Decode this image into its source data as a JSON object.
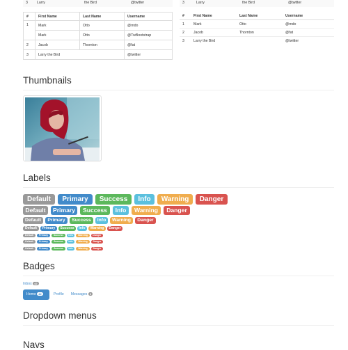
{
  "top_left_remnant": {
    "num": "3",
    "first": "Larry",
    "last": "the Bird",
    "user": "@twitter"
  },
  "top_right_remnant": {
    "num": "3",
    "first": "Larry",
    "last": "the Bird",
    "user": "@twitter"
  },
  "table_left": {
    "headers": [
      "#",
      "First Name",
      "Last Name",
      "Username"
    ],
    "rows": [
      [
        "1",
        "Mark",
        "Otto",
        "@mdo"
      ],
      [
        "",
        "Mark",
        "Otto",
        "@TwBootstrap"
      ],
      [
        "2",
        "Jacob",
        "Thornton",
        "@fat"
      ],
      [
        "3",
        "Larry the Bird",
        "",
        "@twitter"
      ]
    ]
  },
  "table_right": {
    "headers": [
      "#",
      "First Name",
      "Last Name",
      "Username"
    ],
    "rows": [
      [
        "1",
        "Mark",
        "Otto",
        "@mdo"
      ],
      [
        "2",
        "Jacob",
        "Thornton",
        "@fat"
      ],
      [
        "3",
        "Larry the Bird",
        "",
        "@twitter"
      ]
    ]
  },
  "sections": {
    "thumbnails": "Thumbnails",
    "labels": "Labels",
    "badges": "Badges",
    "dropdowns": "Dropdown menus",
    "navs": "Navs"
  },
  "labels": [
    "Default",
    "Primary",
    "Success",
    "Info",
    "Warning",
    "Danger"
  ],
  "badges": {
    "inbox": {
      "label": "Inbox",
      "count": "42"
    },
    "pills": [
      {
        "label": "Home",
        "count": "42",
        "active": true
      },
      {
        "label": "Profile",
        "count": "",
        "active": false
      },
      {
        "label": "Messages",
        "count": "3",
        "active": false
      }
    ]
  },
  "colors": {
    "default": "#999999",
    "primary": "#428bca",
    "success": "#5cb85c",
    "info": "#5bc0de",
    "warning": "#f0ad4e",
    "danger": "#d9534f"
  }
}
